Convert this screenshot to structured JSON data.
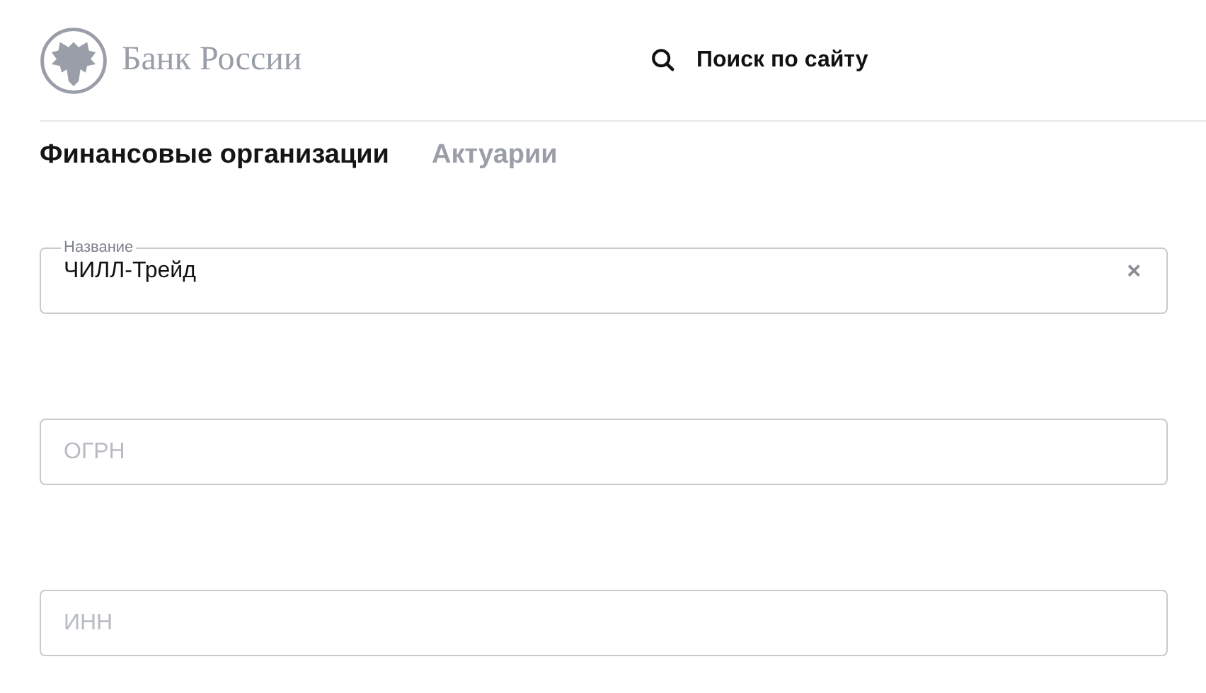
{
  "header": {
    "logo_text": "Банк России",
    "search_label": "Поиск по сайту"
  },
  "tabs": [
    {
      "label": "Финансовые организации",
      "selected": true
    },
    {
      "label": "Актуарии",
      "selected": false
    }
  ],
  "fields": [
    {
      "label": "Название",
      "value": "ЧИЛЛ-Трейд",
      "clear": "×"
    },
    {
      "placeholder": "ОГРН"
    },
    {
      "placeholder": "ИНН"
    }
  ]
}
